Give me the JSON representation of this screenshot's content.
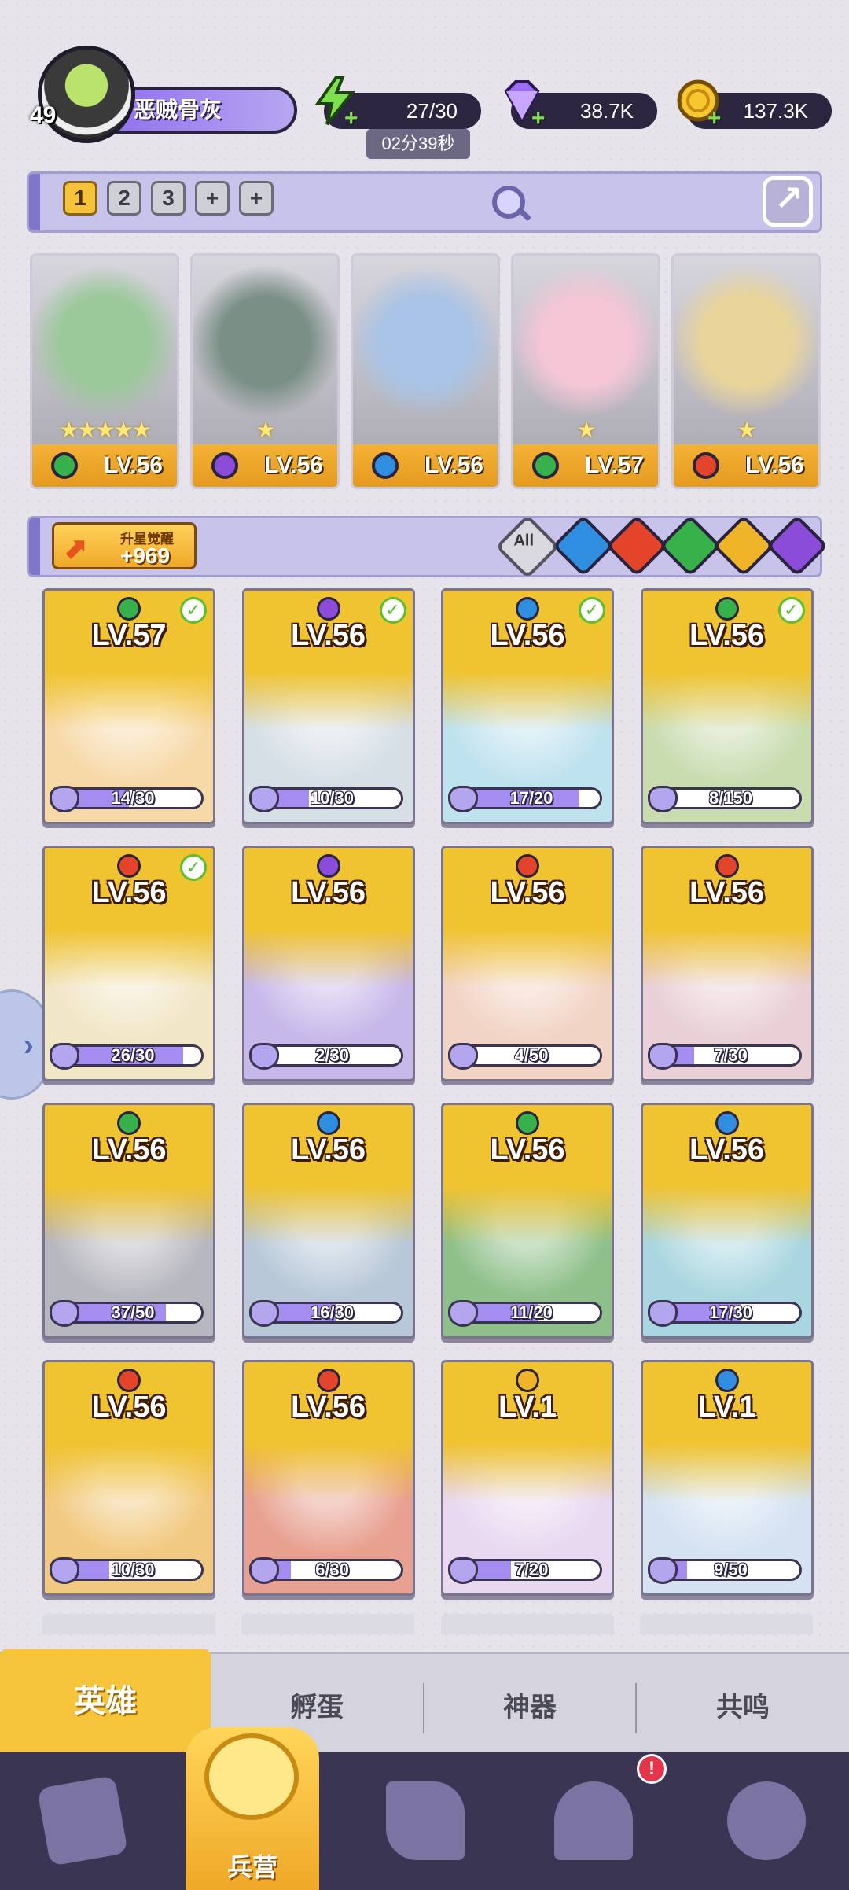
{
  "player": {
    "level": "49",
    "name": "恶贼骨灰"
  },
  "resources": {
    "energy": "27/30",
    "energy_timer": "02分39秒",
    "gems": "38.7K",
    "gold": "137.3K"
  },
  "team_tabs": [
    "1",
    "2",
    "3",
    "+",
    "+"
  ],
  "team": [
    {
      "level": "LV.56",
      "element": "grass",
      "stars": "★★★★★"
    },
    {
      "level": "LV.56",
      "element": "dark",
      "stars": "★"
    },
    {
      "level": "LV.56",
      "element": "water",
      "stars": ""
    },
    {
      "level": "LV.57",
      "element": "grass",
      "stars": "★"
    },
    {
      "level": "LV.56",
      "element": "fire",
      "stars": "★"
    }
  ],
  "star_up": {
    "label": "升星觉醒",
    "value": "+969"
  },
  "filters": {
    "all_label": "All",
    "elements": [
      "water",
      "fire",
      "grass",
      "light",
      "dark"
    ]
  },
  "heroes": [
    {
      "level": "LV.57",
      "element": "grass",
      "shards": "14/30",
      "progress": 0.47,
      "checked": true
    },
    {
      "level": "LV.56",
      "element": "dark",
      "shards": "10/30",
      "progress": 0.33,
      "checked": true
    },
    {
      "level": "LV.56",
      "element": "water",
      "shards": "17/20",
      "progress": 0.85,
      "checked": true
    },
    {
      "level": "LV.56",
      "element": "grass",
      "shards": "8/150",
      "progress": 0.05,
      "checked": true
    },
    {
      "level": "LV.56",
      "element": "fire",
      "shards": "26/30",
      "progress": 0.87,
      "checked": true
    },
    {
      "level": "LV.56",
      "element": "dark",
      "shards": "2/30",
      "progress": 0.07,
      "checked": false
    },
    {
      "level": "LV.56",
      "element": "fire",
      "shards": "4/50",
      "progress": 0.08,
      "checked": false
    },
    {
      "level": "LV.56",
      "element": "fire",
      "shards": "7/30",
      "progress": 0.23,
      "checked": false
    },
    {
      "level": "LV.56",
      "element": "grass",
      "shards": "37/50",
      "progress": 0.74,
      "checked": false
    },
    {
      "level": "LV.56",
      "element": "water",
      "shards": "16/30",
      "progress": 0.53,
      "checked": false
    },
    {
      "level": "LV.56",
      "element": "grass",
      "shards": "11/20",
      "progress": 0.55,
      "checked": false
    },
    {
      "level": "LV.56",
      "element": "water",
      "shards": "17/30",
      "progress": 0.57,
      "checked": false
    },
    {
      "level": "LV.56",
      "element": "fire",
      "shards": "10/30",
      "progress": 0.33,
      "checked": false
    },
    {
      "level": "LV.56",
      "element": "fire",
      "shards": "6/30",
      "progress": 0.2,
      "checked": false
    },
    {
      "level": "LV.1",
      "element": "light",
      "shards": "7/20",
      "progress": 0.35,
      "checked": false
    },
    {
      "level": "LV.1",
      "element": "water",
      "shards": "9/50",
      "progress": 0.18,
      "checked": false
    }
  ],
  "sub_tabs": {
    "heroes": "英雄",
    "hatch": "孵蛋",
    "artifacts": "神器",
    "resonance": "共鸣"
  },
  "bottom_nav": {
    "barracks": "兵营",
    "alert": "!"
  },
  "colors": {
    "grass": "#37b24a",
    "dark": "#8a4cd9",
    "water": "#2f8ee0",
    "fire": "#e4452a",
    "light": "#f0b429",
    "card_gold": "#f0c330",
    "accent_purple": "#8e6cf0"
  }
}
